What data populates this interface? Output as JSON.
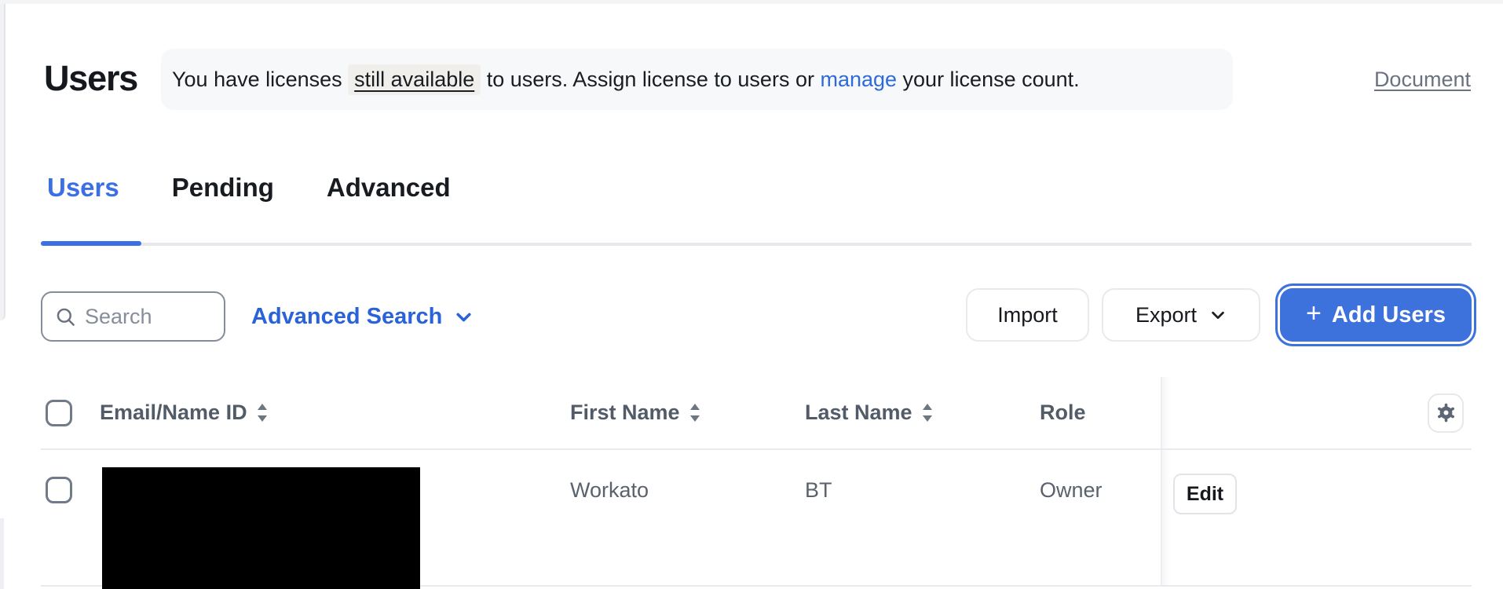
{
  "header": {
    "title": "Users",
    "doc_link": "Document"
  },
  "banner": {
    "before": "You have licenses ",
    "highlight": "still available",
    "middle": " to users. Assign license to users or ",
    "link": "manage",
    "after": " your license count."
  },
  "tabs": {
    "users": "Users",
    "pending": "Pending",
    "advanced": "Advanced"
  },
  "toolbar": {
    "search_placeholder": "Search",
    "advanced_search": "Advanced Search",
    "import_label": "Import",
    "export_label": "Export",
    "plus": "+",
    "add_users_label": "Add Users"
  },
  "table": {
    "columns": {
      "email": "Email/Name ID",
      "first_name": "First Name",
      "last_name": "Last Name",
      "role": "Role"
    },
    "row": {
      "first_name": "Workato",
      "last_name": "BT",
      "role": "Owner",
      "edit_label": "Edit"
    }
  },
  "colors": {
    "accent_blue": "#3b6fe3",
    "button_blue": "#3d71dc",
    "link_blue": "#2e6ada"
  }
}
